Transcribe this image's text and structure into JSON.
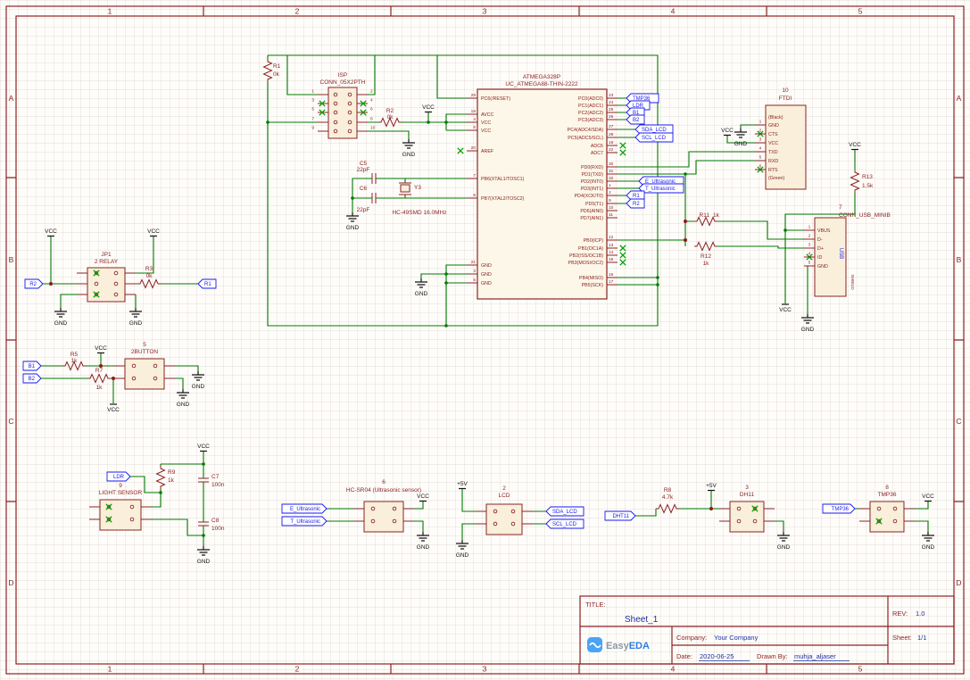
{
  "frame": {
    "cols": [
      "1",
      "2",
      "3",
      "4",
      "5"
    ],
    "rows": [
      "A",
      "B",
      "C",
      "D"
    ]
  },
  "power": {
    "vcc": "VCC",
    "gnd": "GND",
    "p5v": "+5V"
  },
  "nets": {
    "tmp36": "TMP36",
    "ldr": "LDR",
    "b1": "B1",
    "b2": "B2",
    "sda_lcd": "SDA_LCD",
    "scl_lcd": "SCL_LCD",
    "e_ultrasonic": "E_Ultrasonic",
    "t_ultrasonic": "T_Ultrasonic",
    "r1": "R1",
    "r2": "R2",
    "dht11": "DHT11"
  },
  "parts": {
    "r1": {
      "ref": "R1",
      "val": "0k"
    },
    "r2": {
      "ref": "R2",
      "val": "0k"
    },
    "r3": {
      "ref": "R3",
      "val": "0k"
    },
    "r5": {
      "ref": "R5",
      "val": "1k"
    },
    "r7": {
      "ref": "R7",
      "val": "1k"
    },
    "r8": {
      "ref": "R8",
      "val": "4.7k"
    },
    "r9": {
      "ref": "R9",
      "val": "1k"
    },
    "r11": {
      "ref": "R11",
      "val": "1k"
    },
    "r12": {
      "ref": "R12",
      "val": "1k"
    },
    "r13": {
      "ref": "R13",
      "val": "1.5k"
    },
    "c5": {
      "ref": "C5",
      "val": "22pF"
    },
    "c6": {
      "ref": "C6",
      "val": "22pF"
    },
    "c7": {
      "ref": "C7",
      "val": "100n"
    },
    "c8": {
      "ref": "C8",
      "val": "100n"
    },
    "y3": {
      "ref": "Y3",
      "val": "HC-49SMD 16.0MHz"
    },
    "isp": {
      "ref": "ISP",
      "val": "CONN_05X2PTH",
      "left_numbers": [
        "1",
        "3",
        "5",
        "7",
        "9"
      ],
      "right_numbers": [
        "2",
        "4",
        "6",
        "8",
        "10"
      ]
    },
    "ic": {
      "ref": "ATMEGA328P",
      "val": "UC_ATMEGA88-THIN-2222",
      "left_pins": [
        {
          "num": "29",
          "name": "PC6(/RESET)"
        },
        {
          "num": "18",
          "name": "AVCC"
        },
        {
          "num": "4",
          "name": "VCC"
        },
        {
          "num": "6",
          "name": "VCC"
        },
        {
          "num": "20",
          "name": "AREF"
        },
        {
          "num": "7",
          "name": "PB6(XTAL1/TOSC1)"
        },
        {
          "num": "8",
          "name": "PB7(XTAL2/TOSC2)"
        },
        {
          "num": "21",
          "name": "GND"
        },
        {
          "num": "3",
          "name": "GND"
        },
        {
          "num": "5",
          "name": "GND"
        }
      ],
      "right_pins": [
        {
          "num": "23",
          "name": "PC0(ADC0)"
        },
        {
          "num": "24",
          "name": "PC1(ADC1)"
        },
        {
          "num": "25",
          "name": "PC2(ADC2)"
        },
        {
          "num": "26",
          "name": "PC3(ADC3)"
        },
        {
          "num": "27",
          "name": "PC4(ADC4/SDA)"
        },
        {
          "num": "28",
          "name": "PC5(ADC5/SCL)"
        },
        {
          "num": "19",
          "name": "ADC6"
        },
        {
          "num": "22",
          "name": "ADC7"
        },
        {
          "num": "30",
          "name": "PD0(RXD)"
        },
        {
          "num": "31",
          "name": "PD1(TXD)"
        },
        {
          "num": "32",
          "name": "PD2(INT0)"
        },
        {
          "num": "1",
          "name": "PD3(INT1)"
        },
        {
          "num": "2",
          "name": "PD4(XCK/T0)"
        },
        {
          "num": "9",
          "name": "PD5(T1)"
        },
        {
          "num": "10",
          "name": "PD6(AIN0)"
        },
        {
          "num": "11",
          "name": "PD7(AIN1)"
        },
        {
          "num": "12",
          "name": "PB0(ICP)"
        },
        {
          "num": "13",
          "name": "PB1(OC1A)"
        },
        {
          "num": "14",
          "name": "PB2(/SS/OC1B)"
        },
        {
          "num": "15",
          "name": "PB3(MOSI/OC2)"
        },
        {
          "num": "16",
          "name": "PB4(MISO)"
        },
        {
          "num": "17",
          "name": "PB5(SCK)"
        }
      ]
    },
    "ftdi": {
      "num": "10",
      "name": "FTDI",
      "lines": [
        "(Black)",
        "GND",
        "CTS",
        "VCC",
        "TXD",
        "RXD",
        "RTS",
        "(Green)"
      ],
      "pin_numbers": [
        "1",
        "2",
        "3",
        "4",
        "5",
        "6"
      ]
    },
    "usb": {
      "num": "7",
      "name": "CONN_USB_MINIB",
      "pin_names": [
        "VBUS",
        "D-",
        "D+",
        "ID",
        "GND"
      ],
      "pin_numbers": [
        "1",
        "2",
        "3",
        "4",
        "5"
      ],
      "side_label": "USB",
      "shield_label": "SHIELD"
    },
    "jp1": {
      "num": "JP1",
      "name": "2 RELAY"
    },
    "btn": {
      "num": "5",
      "name": "2BUTTON"
    },
    "light": {
      "num": "9",
      "name": "LIGHT SENSOR"
    },
    "sr04": {
      "num": "6",
      "name": "HC-SR04 (Ultrasonic sensor)"
    },
    "lcd": {
      "num": "2",
      "name": "LCD"
    },
    "dht": {
      "num": "3",
      "name": "DH11"
    },
    "tmp": {
      "num": "8",
      "name": "TMP36"
    }
  },
  "title_block": {
    "title_label": "TITLE:",
    "title": "Sheet_1",
    "rev_label": "REV:",
    "rev": "1.0",
    "company_label": "Company:",
    "company": "Your Company",
    "sheet_label": "Sheet:",
    "sheet": "1/1",
    "date_label": "Date:",
    "date": "2020-06-25",
    "drawn_label": "Drawn By:",
    "drawn_by": "muhja_aljaser",
    "logo": {
      "easy": "Easy",
      "eda": "EDA"
    }
  }
}
